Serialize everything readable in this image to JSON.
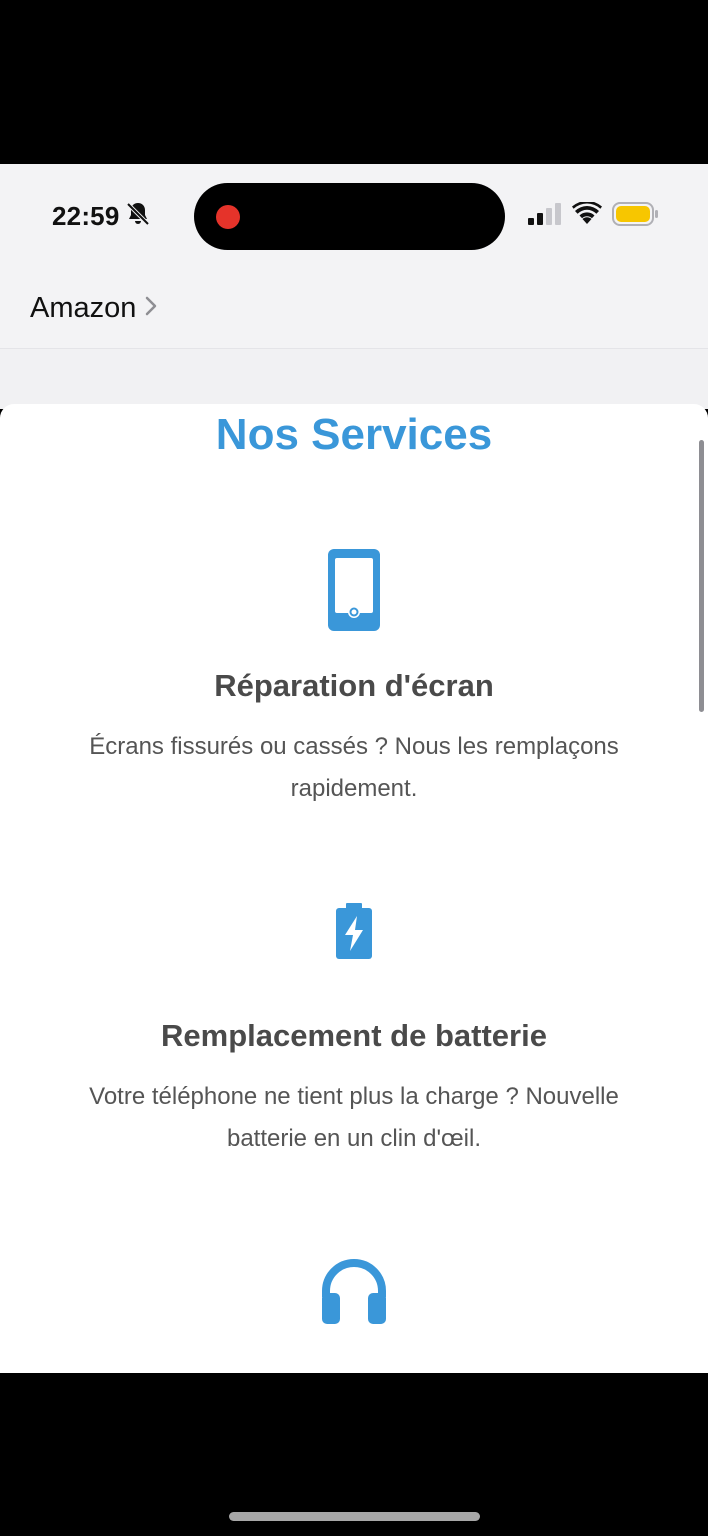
{
  "status_bar": {
    "time": "22:59"
  },
  "nav": {
    "back_label": "Amazon"
  },
  "page": {
    "section_title": "Nos Services",
    "accent_color": "#3a97d9",
    "services": [
      {
        "icon": "mobile-phone-icon",
        "title": "Réparation d'écran",
        "description": "Écrans fissurés ou cassés ? Nous les remplaçons rapidement."
      },
      {
        "icon": "battery-charging-icon",
        "title": "Remplacement de batterie",
        "description": "Votre téléphone ne tient plus la charge ? Nouvelle batterie en un clin d'œil."
      },
      {
        "icon": "headphones-icon",
        "title": "",
        "description": ""
      }
    ]
  },
  "colors": {
    "recording_dot": "#e5332a",
    "battery_fill": "#f7c600"
  }
}
